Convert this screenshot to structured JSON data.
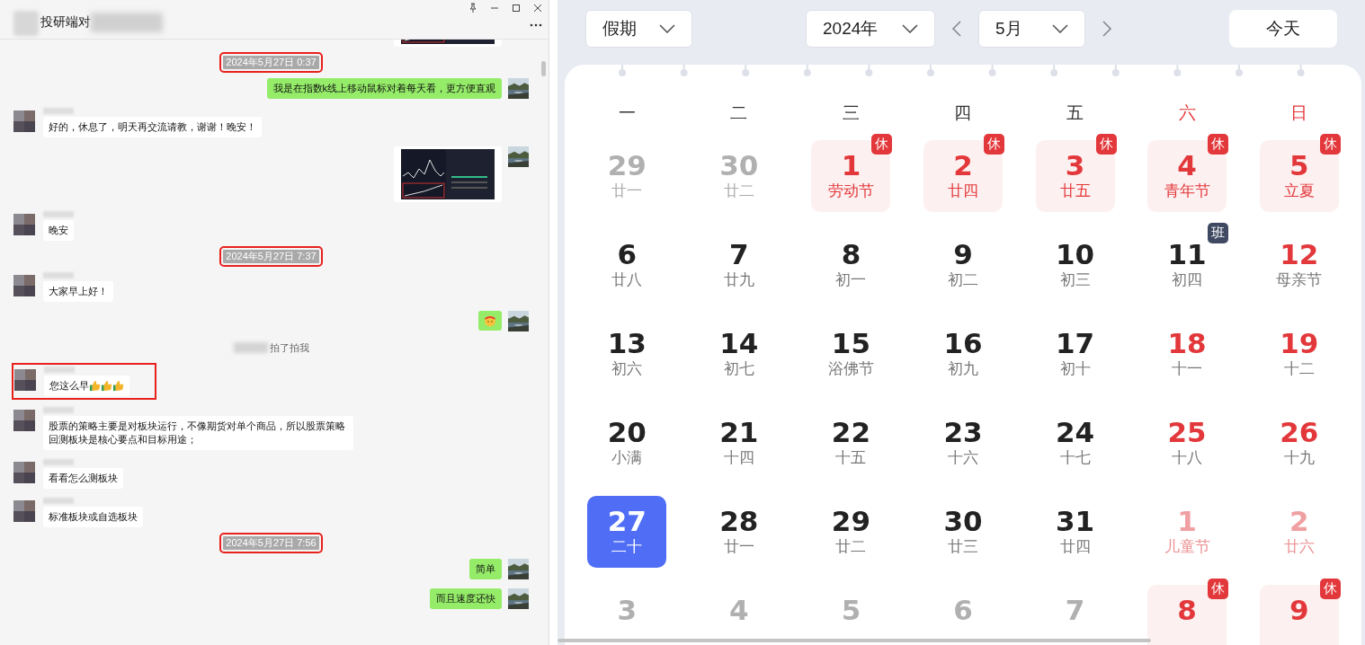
{
  "chat": {
    "title": "投研端对",
    "messages": [
      {
        "kind": "out_image",
        "highlighted": false,
        "partial": true
      },
      {
        "kind": "time",
        "text": "2024年5月27日 0:37",
        "highlighted": true
      },
      {
        "kind": "out",
        "text": "我是在指数k线上移动鼠标对着每天看，更方便直观",
        "highlighted": false
      },
      {
        "kind": "in",
        "text": "好的，休息了，明天再交流请教，谢谢！晚安！",
        "highlighted": false
      },
      {
        "kind": "out_image",
        "highlighted": false,
        "partial": false
      },
      {
        "kind": "in",
        "text": "晚安",
        "highlighted": false
      },
      {
        "kind": "time",
        "text": "2024年5月27日 7:37",
        "highlighted": true
      },
      {
        "kind": "in",
        "text": "大家早上好！",
        "highlighted": false
      },
      {
        "kind": "out_sticker",
        "highlighted": false
      },
      {
        "kind": "system",
        "text": "拍了拍我",
        "highlighted": false
      },
      {
        "kind": "in",
        "text": "您这么早",
        "emojis": [
          {
            "kind": "thumbs_up"
          },
          {
            "kind": "thumbs_up"
          },
          {
            "kind": "thumbs_up"
          }
        ],
        "highlighted": true
      },
      {
        "kind": "in",
        "text": "股票的策略主要是对板块运行，不像期货对单个商品，所以股票策略回测板块是核心要点和目标用途；",
        "highlighted": false
      },
      {
        "kind": "in",
        "text": "看看怎么测板块",
        "highlighted": false
      },
      {
        "kind": "in",
        "text": "标准板块或自选板块",
        "highlighted": false
      },
      {
        "kind": "time",
        "text": "2024年5月27日 7:56",
        "highlighted": true
      },
      {
        "kind": "out",
        "text": "简单",
        "highlighted": false
      },
      {
        "kind": "out",
        "text": "而且速度还快",
        "highlighted": false
      }
    ]
  },
  "calendar": {
    "holiday_select": "假期",
    "year_select": "2024年",
    "month_select": "5月",
    "today_button": "今天",
    "weekdays": [
      {
        "label": "一",
        "weekend": false
      },
      {
        "label": "二",
        "weekend": false
      },
      {
        "label": "三",
        "weekend": false
      },
      {
        "label": "四",
        "weekend": false
      },
      {
        "label": "五",
        "weekend": false
      },
      {
        "label": "六",
        "weekend": true
      },
      {
        "label": "日",
        "weekend": true
      }
    ],
    "days": [
      {
        "day": "29",
        "lunar": "廿一",
        "other_month": true,
        "red": false,
        "rest": false,
        "selected": false
      },
      {
        "day": "30",
        "lunar": "廿二",
        "other_month": true,
        "red": false,
        "rest": false,
        "selected": false
      },
      {
        "day": "1",
        "lunar": "劳动节",
        "other_month": false,
        "red": true,
        "rest": true,
        "badge": "休",
        "selected": false
      },
      {
        "day": "2",
        "lunar": "廿四",
        "other_month": false,
        "red": true,
        "rest": true,
        "badge": "休",
        "selected": false
      },
      {
        "day": "3",
        "lunar": "廿五",
        "other_month": false,
        "red": true,
        "rest": true,
        "badge": "休",
        "selected": false
      },
      {
        "day": "4",
        "lunar": "青年节",
        "other_month": false,
        "red": true,
        "rest": true,
        "badge": "休",
        "selected": false
      },
      {
        "day": "5",
        "lunar": "立夏",
        "other_month": false,
        "red": true,
        "rest": true,
        "badge": "休",
        "selected": false
      },
      {
        "day": "6",
        "lunar": "廿八",
        "other_month": false,
        "red": false,
        "rest": false,
        "selected": false
      },
      {
        "day": "7",
        "lunar": "廿九",
        "other_month": false,
        "red": false,
        "rest": false,
        "selected": false
      },
      {
        "day": "8",
        "lunar": "初一",
        "other_month": false,
        "red": false,
        "rest": false,
        "selected": false
      },
      {
        "day": "9",
        "lunar": "初二",
        "other_month": false,
        "red": false,
        "rest": false,
        "selected": false
      },
      {
        "day": "10",
        "lunar": "初三",
        "other_month": false,
        "red": false,
        "rest": false,
        "selected": false
      },
      {
        "day": "11",
        "lunar": "初四",
        "other_month": false,
        "red": false,
        "rest": false,
        "badge": "班",
        "selected": false
      },
      {
        "day": "12",
        "lunar": "母亲节",
        "other_month": false,
        "red": true,
        "rest": false,
        "selected": false
      },
      {
        "day": "13",
        "lunar": "初六",
        "other_month": false,
        "red": false,
        "rest": false,
        "selected": false
      },
      {
        "day": "14",
        "lunar": "初七",
        "other_month": false,
        "red": false,
        "rest": false,
        "selected": false
      },
      {
        "day": "15",
        "lunar": "浴佛节",
        "other_month": false,
        "red": false,
        "rest": false,
        "selected": false
      },
      {
        "day": "16",
        "lunar": "初九",
        "other_month": false,
        "red": false,
        "rest": false,
        "selected": false
      },
      {
        "day": "17",
        "lunar": "初十",
        "other_month": false,
        "red": false,
        "rest": false,
        "selected": false
      },
      {
        "day": "18",
        "lunar": "十一",
        "other_month": false,
        "red": true,
        "rest": false,
        "selected": false
      },
      {
        "day": "19",
        "lunar": "十二",
        "other_month": false,
        "red": true,
        "rest": false,
        "selected": false
      },
      {
        "day": "20",
        "lunar": "小满",
        "other_month": false,
        "red": false,
        "rest": false,
        "selected": false
      },
      {
        "day": "21",
        "lunar": "十四",
        "other_month": false,
        "red": false,
        "rest": false,
        "selected": false
      },
      {
        "day": "22",
        "lunar": "十五",
        "other_month": false,
        "red": false,
        "rest": false,
        "selected": false
      },
      {
        "day": "23",
        "lunar": "十六",
        "other_month": false,
        "red": false,
        "rest": false,
        "selected": false
      },
      {
        "day": "24",
        "lunar": "十七",
        "other_month": false,
        "red": false,
        "rest": false,
        "selected": false
      },
      {
        "day": "25",
        "lunar": "十八",
        "other_month": false,
        "red": true,
        "rest": false,
        "selected": false
      },
      {
        "day": "26",
        "lunar": "十九",
        "other_month": false,
        "red": true,
        "rest": false,
        "selected": false
      },
      {
        "day": "27",
        "lunar": "二十",
        "other_month": false,
        "red": false,
        "rest": false,
        "selected": true
      },
      {
        "day": "28",
        "lunar": "廿一",
        "other_month": false,
        "red": false,
        "rest": false,
        "selected": false
      },
      {
        "day": "29",
        "lunar": "廿二",
        "other_month": false,
        "red": false,
        "rest": false,
        "selected": false
      },
      {
        "day": "30",
        "lunar": "廿三",
        "other_month": false,
        "red": false,
        "rest": false,
        "selected": false
      },
      {
        "day": "31",
        "lunar": "廿四",
        "other_month": false,
        "red": false,
        "rest": false,
        "selected": false
      },
      {
        "day": "1",
        "lunar": "儿童节",
        "other_month": true,
        "red": true,
        "rest": false,
        "selected": false
      },
      {
        "day": "2",
        "lunar": "廿六",
        "other_month": true,
        "red": true,
        "rest": false,
        "selected": false
      },
      {
        "day": "3",
        "other_month": true,
        "red": false,
        "rest": false,
        "selected": false
      },
      {
        "day": "4",
        "other_month": true,
        "red": false,
        "rest": false,
        "selected": false
      },
      {
        "day": "5",
        "other_month": true,
        "red": false,
        "rest": false,
        "selected": false
      },
      {
        "day": "6",
        "other_month": true,
        "red": false,
        "rest": false,
        "selected": false
      },
      {
        "day": "7",
        "other_month": true,
        "red": false,
        "rest": false,
        "selected": false
      },
      {
        "day": "8",
        "other_month": true,
        "red": true,
        "rest": true,
        "badge": "休",
        "selected": false
      },
      {
        "day": "9",
        "other_month": true,
        "red": true,
        "rest": true,
        "badge": "休",
        "selected": false
      }
    ]
  }
}
